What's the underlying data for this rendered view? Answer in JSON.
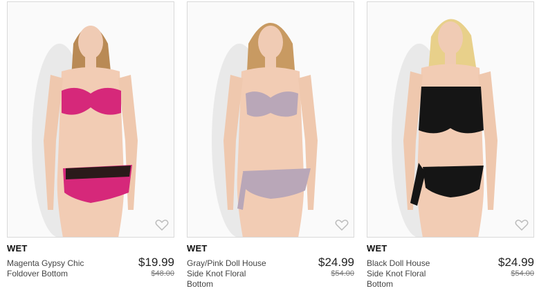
{
  "products": [
    {
      "brand": "WET",
      "name_lines": [
        "Magenta Gypsy Chic",
        "Foldover Bottom"
      ],
      "price": "$19.99",
      "original_price": "$48.00",
      "swimsuit_color": "#d6287a",
      "hair_color": "#b98a55",
      "icon": "heart-outline-icon"
    },
    {
      "brand": "WET",
      "name_lines": [
        "Gray/Pink Doll House",
        "Side Knot Floral",
        "Bottom"
      ],
      "price": "$24.99",
      "original_price": "$54.00",
      "swimsuit_color": "#b9a7b8",
      "hair_color": "#c89a62",
      "icon": "heart-outline-icon"
    },
    {
      "brand": "WET",
      "name_lines": [
        "Black Doll House",
        "Side Knot Floral",
        "Bottom"
      ],
      "price": "$24.99",
      "original_price": "$54.00",
      "swimsuit_color": "#151515",
      "hair_color": "#e8d08a",
      "icon": "heart-outline-icon"
    }
  ]
}
